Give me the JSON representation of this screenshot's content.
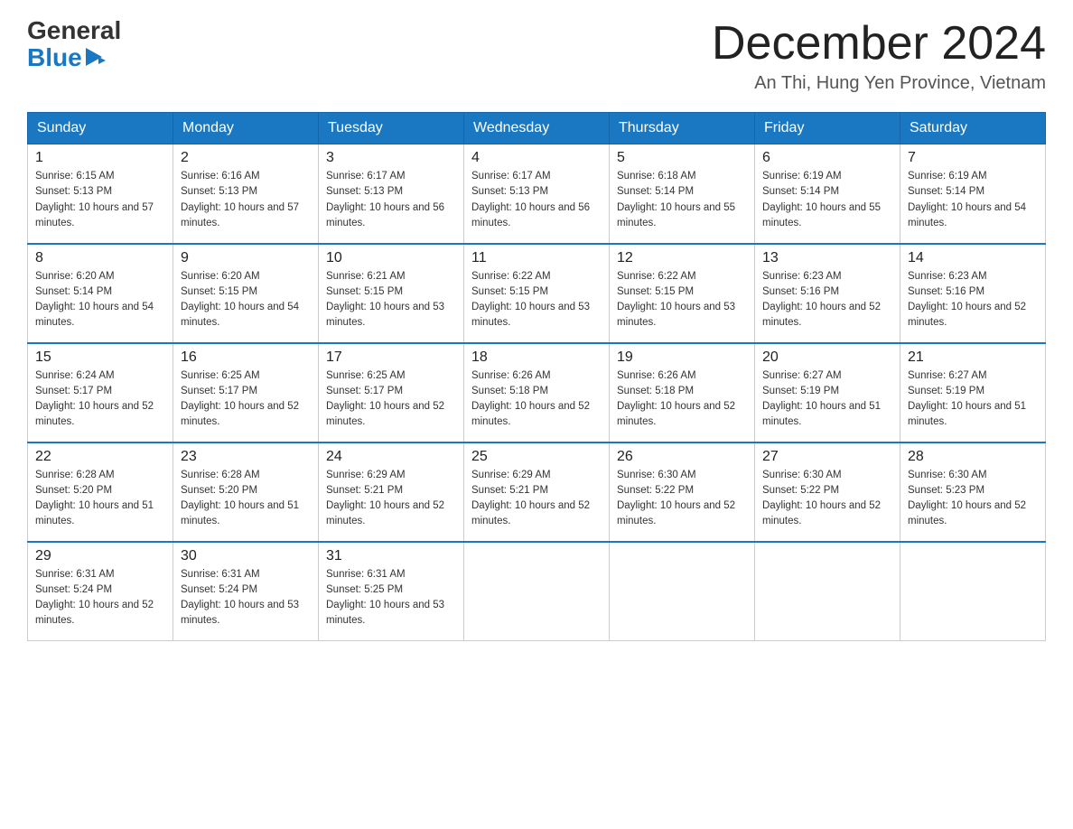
{
  "header": {
    "logo_general": "General",
    "logo_blue": "Blue",
    "month_title": "December 2024",
    "location": "An Thi, Hung Yen Province, Vietnam"
  },
  "days_of_week": [
    "Sunday",
    "Monday",
    "Tuesday",
    "Wednesday",
    "Thursday",
    "Friday",
    "Saturday"
  ],
  "weeks": [
    [
      {
        "day": "1",
        "sunrise": "6:15 AM",
        "sunset": "5:13 PM",
        "daylight": "10 hours and 57 minutes."
      },
      {
        "day": "2",
        "sunrise": "6:16 AM",
        "sunset": "5:13 PM",
        "daylight": "10 hours and 57 minutes."
      },
      {
        "day": "3",
        "sunrise": "6:17 AM",
        "sunset": "5:13 PM",
        "daylight": "10 hours and 56 minutes."
      },
      {
        "day": "4",
        "sunrise": "6:17 AM",
        "sunset": "5:13 PM",
        "daylight": "10 hours and 56 minutes."
      },
      {
        "day": "5",
        "sunrise": "6:18 AM",
        "sunset": "5:14 PM",
        "daylight": "10 hours and 55 minutes."
      },
      {
        "day": "6",
        "sunrise": "6:19 AM",
        "sunset": "5:14 PM",
        "daylight": "10 hours and 55 minutes."
      },
      {
        "day": "7",
        "sunrise": "6:19 AM",
        "sunset": "5:14 PM",
        "daylight": "10 hours and 54 minutes."
      }
    ],
    [
      {
        "day": "8",
        "sunrise": "6:20 AM",
        "sunset": "5:14 PM",
        "daylight": "10 hours and 54 minutes."
      },
      {
        "day": "9",
        "sunrise": "6:20 AM",
        "sunset": "5:15 PM",
        "daylight": "10 hours and 54 minutes."
      },
      {
        "day": "10",
        "sunrise": "6:21 AM",
        "sunset": "5:15 PM",
        "daylight": "10 hours and 53 minutes."
      },
      {
        "day": "11",
        "sunrise": "6:22 AM",
        "sunset": "5:15 PM",
        "daylight": "10 hours and 53 minutes."
      },
      {
        "day": "12",
        "sunrise": "6:22 AM",
        "sunset": "5:15 PM",
        "daylight": "10 hours and 53 minutes."
      },
      {
        "day": "13",
        "sunrise": "6:23 AM",
        "sunset": "5:16 PM",
        "daylight": "10 hours and 52 minutes."
      },
      {
        "day": "14",
        "sunrise": "6:23 AM",
        "sunset": "5:16 PM",
        "daylight": "10 hours and 52 minutes."
      }
    ],
    [
      {
        "day": "15",
        "sunrise": "6:24 AM",
        "sunset": "5:17 PM",
        "daylight": "10 hours and 52 minutes."
      },
      {
        "day": "16",
        "sunrise": "6:25 AM",
        "sunset": "5:17 PM",
        "daylight": "10 hours and 52 minutes."
      },
      {
        "day": "17",
        "sunrise": "6:25 AM",
        "sunset": "5:17 PM",
        "daylight": "10 hours and 52 minutes."
      },
      {
        "day": "18",
        "sunrise": "6:26 AM",
        "sunset": "5:18 PM",
        "daylight": "10 hours and 52 minutes."
      },
      {
        "day": "19",
        "sunrise": "6:26 AM",
        "sunset": "5:18 PM",
        "daylight": "10 hours and 52 minutes."
      },
      {
        "day": "20",
        "sunrise": "6:27 AM",
        "sunset": "5:19 PM",
        "daylight": "10 hours and 51 minutes."
      },
      {
        "day": "21",
        "sunrise": "6:27 AM",
        "sunset": "5:19 PM",
        "daylight": "10 hours and 51 minutes."
      }
    ],
    [
      {
        "day": "22",
        "sunrise": "6:28 AM",
        "sunset": "5:20 PM",
        "daylight": "10 hours and 51 minutes."
      },
      {
        "day": "23",
        "sunrise": "6:28 AM",
        "sunset": "5:20 PM",
        "daylight": "10 hours and 51 minutes."
      },
      {
        "day": "24",
        "sunrise": "6:29 AM",
        "sunset": "5:21 PM",
        "daylight": "10 hours and 52 minutes."
      },
      {
        "day": "25",
        "sunrise": "6:29 AM",
        "sunset": "5:21 PM",
        "daylight": "10 hours and 52 minutes."
      },
      {
        "day": "26",
        "sunrise": "6:30 AM",
        "sunset": "5:22 PM",
        "daylight": "10 hours and 52 minutes."
      },
      {
        "day": "27",
        "sunrise": "6:30 AM",
        "sunset": "5:22 PM",
        "daylight": "10 hours and 52 minutes."
      },
      {
        "day": "28",
        "sunrise": "6:30 AM",
        "sunset": "5:23 PM",
        "daylight": "10 hours and 52 minutes."
      }
    ],
    [
      {
        "day": "29",
        "sunrise": "6:31 AM",
        "sunset": "5:24 PM",
        "daylight": "10 hours and 52 minutes."
      },
      {
        "day": "30",
        "sunrise": "6:31 AM",
        "sunset": "5:24 PM",
        "daylight": "10 hours and 53 minutes."
      },
      {
        "day": "31",
        "sunrise": "6:31 AM",
        "sunset": "5:25 PM",
        "daylight": "10 hours and 53 minutes."
      },
      null,
      null,
      null,
      null
    ]
  ]
}
